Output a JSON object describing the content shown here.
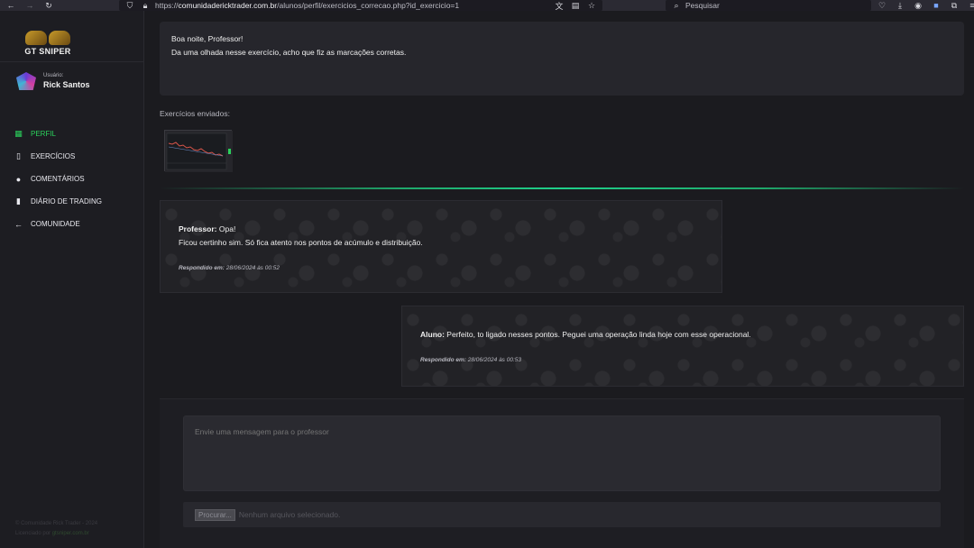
{
  "browser": {
    "url_prefix": "https://",
    "url_domain": "comunidadericktrader.com.br",
    "url_path": "/alunos/perfil/exercicios_correcao.php?id_exercicio=1",
    "search_placeholder": "Pesquisar"
  },
  "sidebar": {
    "logo_text": "GT SNIPER",
    "user_label": "Usuário:",
    "user_name": "Rick Santos",
    "items": [
      {
        "label": "PERFIL",
        "icon": "grid-icon",
        "active": true
      },
      {
        "label": "EXERCÍCIOS",
        "icon": "document-icon",
        "active": false
      },
      {
        "label": "COMENTÁRIOS",
        "icon": "chat-icon",
        "active": false
      },
      {
        "label": "DIÁRIO DE TRADING",
        "icon": "journal-icon",
        "active": false
      },
      {
        "label": "COMUNIDADE",
        "icon": "arrow-left-icon",
        "active": false
      }
    ],
    "footer_line1": "© Comunidade Rick Trader - 2024",
    "footer_line2_prefix": "Licenciado por ",
    "footer_line2_link": "gtsniper.com.br"
  },
  "main": {
    "student_message_line1": "Boa noite, Professor!",
    "student_message_line2": "Da uma olhada nesse exercício, acho que fiz as marcações corretas.",
    "sent_label": "Exercícios enviados:",
    "professor_reply": {
      "author": "Professor:",
      "line1": "Opa!",
      "line2": "Ficou certinho sim. Só fica atento nos pontos de acúmulo e distribuição.",
      "answered_label": "Respondido em:",
      "answered_time": "28/06/2024 às 00:52"
    },
    "student_reply": {
      "author": "Aluno:",
      "text": "Perfeito, to ligado nesses pontos. Peguei uma operação linda hoje com esse operacional.",
      "answered_label": "Respondido em:",
      "answered_time": "28/06/2024 às 00:53"
    },
    "reply_placeholder": "Envie uma mensagem para o professor",
    "file_button": "Procurar...",
    "file_status": "Nenhum arquivo selecionado."
  }
}
